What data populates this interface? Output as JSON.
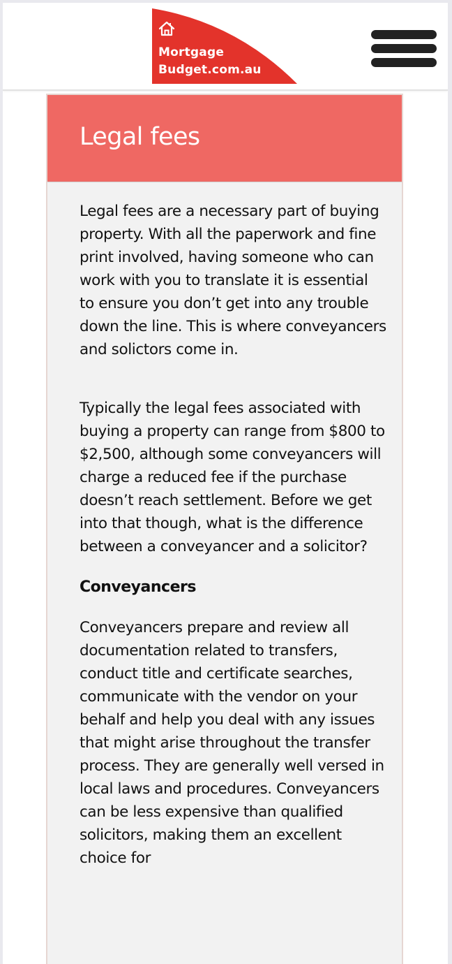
{
  "header": {
    "logo": {
      "line1": "Mortgage",
      "line2": "Budget.com.au",
      "icon": "house-icon",
      "color": "#e3332b"
    },
    "menu_icon": "hamburger-menu-icon"
  },
  "card": {
    "title": "Legal fees",
    "header_color": "#ef6863",
    "paragraphs": {
      "p1": "Legal fees are a necessary part of buying property. With all the paperwork and fine print involved, having someone who can work with you to translate it is essential to ensure you don’t get into any trouble down the line. This is where conveyancers and solictors come in.",
      "p2": "Typically the legal fees associated with buying a property can range from $800 to $2,500, although some conveyancers will charge a reduced fee if the purchase doesn’t reach settlement. Before we get into that though, what is the difference between a conveyancer and a solicitor?"
    },
    "subheading": "Conveyancers",
    "paragraph3": "Conveyancers prepare and review all documentation related to transfers, conduct title and certificate searches, communicate with the vendor on your behalf and help you deal with any issues that might arise throughout the transfer process. They are generally well versed in local laws and procedures. Conveyancers can be less expensive than qualified solicitors, making them an excellent choice for"
  }
}
